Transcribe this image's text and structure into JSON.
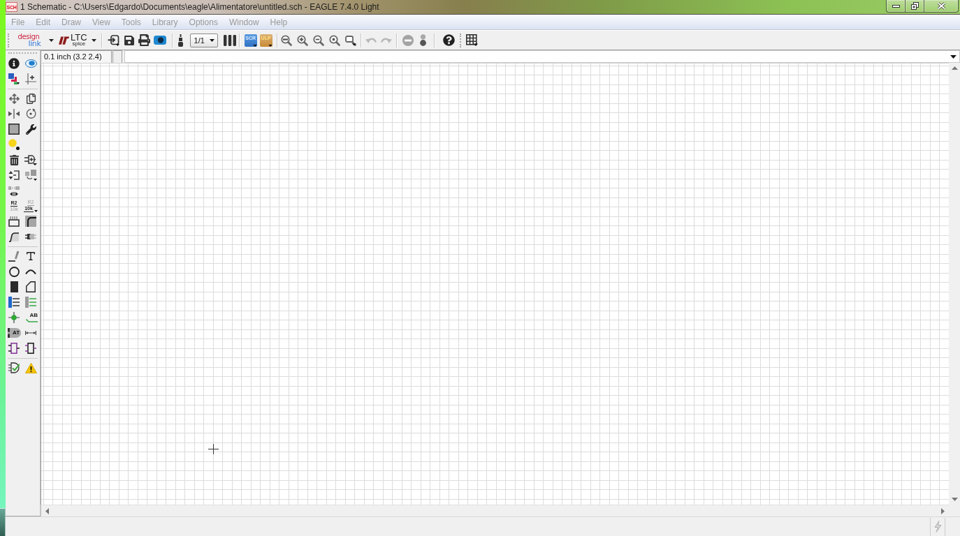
{
  "window": {
    "icon_label": "SCH",
    "title": "1 Schematic - C:\\Users\\Edgardo\\Documents\\eagle\\Alimentatore\\untitled.sch - EAGLE 7.4.0 Light"
  },
  "menu": [
    {
      "label": "File",
      "disabled": true
    },
    {
      "label": "Edit",
      "disabled": true
    },
    {
      "label": "Draw",
      "disabled": true
    },
    {
      "label": "View",
      "disabled": true
    },
    {
      "label": "Tools",
      "disabled": true
    },
    {
      "label": "Library",
      "disabled": true
    },
    {
      "label": "Options",
      "disabled": true
    },
    {
      "label": "Window",
      "disabled": true
    },
    {
      "label": "Help",
      "disabled": true
    }
  ],
  "toolbar": {
    "design_link": {
      "line_1": "design",
      "line_2": "link"
    },
    "ltc_spice": {
      "line_1": "LTC",
      "line_2": "spice"
    },
    "sheet_select": {
      "value": "1/1"
    },
    "script": {
      "label": "SCR"
    },
    "ulp": {
      "label": "ULP"
    },
    "undo": {
      "disabled": true
    },
    "redo": {
      "disabled": true
    },
    "stop": {
      "disabled": true
    },
    "go": {
      "disabled": true
    }
  },
  "command_bar": {
    "coordinates": "0.1 inch (3.2 2.4)"
  },
  "palette": {
    "name_tool": {
      "line_1": "R2",
      "line_2": "10k"
    },
    "value_tool": {
      "line_1": "R2",
      "line_2": "10k"
    },
    "label_tool": {
      "label": "AB"
    },
    "attribute_tool": {
      "label": "AT"
    }
  }
}
